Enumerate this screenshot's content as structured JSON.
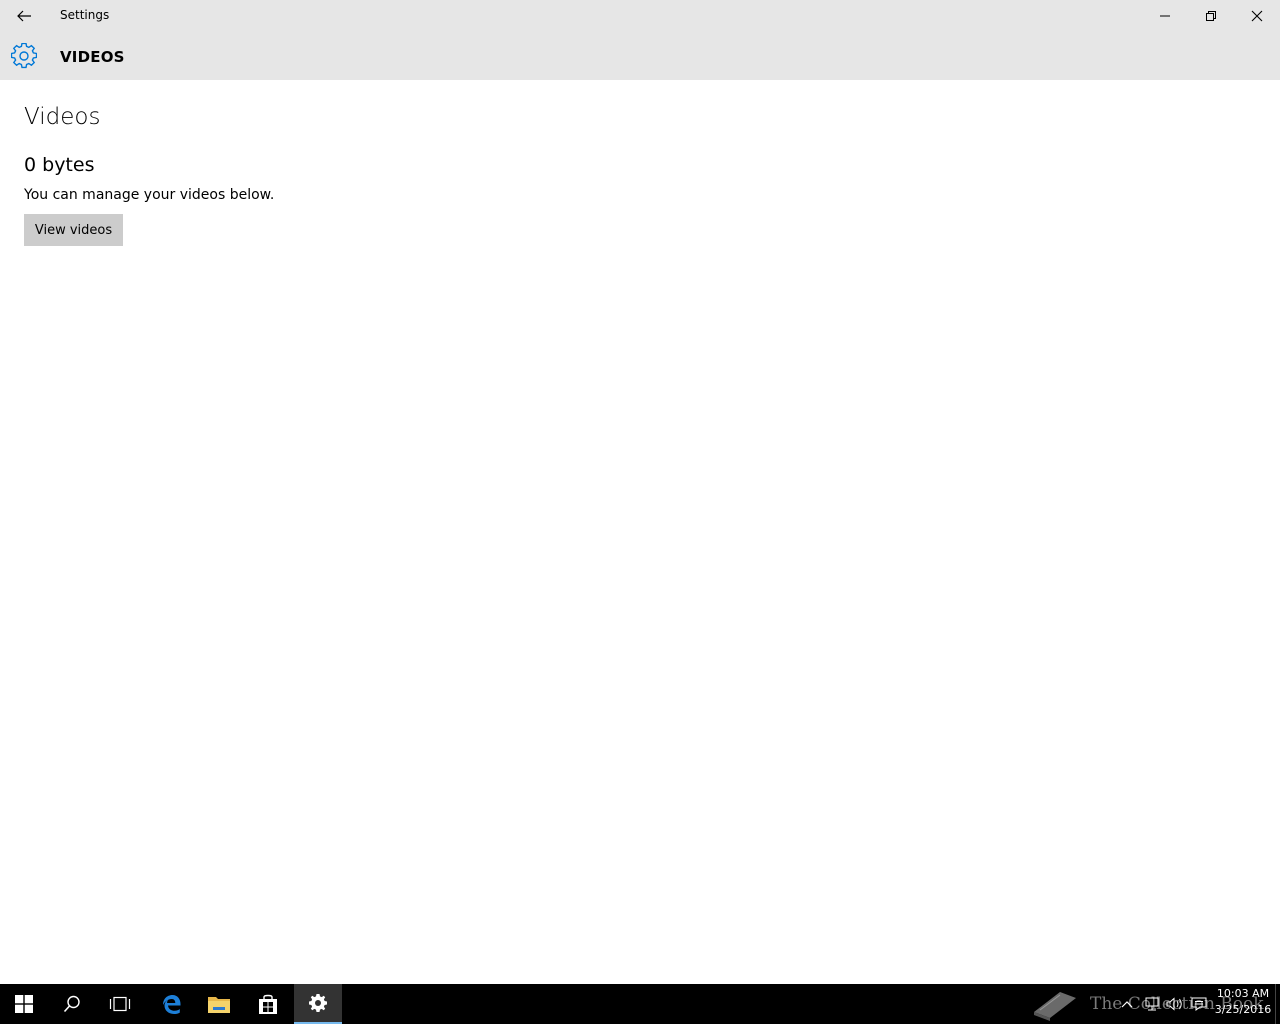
{
  "window": {
    "title": "Settings",
    "controls": [
      "minimize",
      "restore",
      "close"
    ]
  },
  "header": {
    "section": "VIDEOS",
    "icon": "gear-icon",
    "accent": "#0078d7"
  },
  "main": {
    "title": "Videos",
    "size": "0 bytes",
    "description": "You can manage your videos below.",
    "view_button": "View videos"
  },
  "taskbar": {
    "items": [
      "start",
      "search",
      "task-view",
      "edge",
      "file-explorer",
      "store",
      "settings"
    ],
    "active": "settings",
    "watermark": "The Collection Book",
    "clock": {
      "time": "10:03 AM",
      "date": "3/25/2016"
    }
  }
}
